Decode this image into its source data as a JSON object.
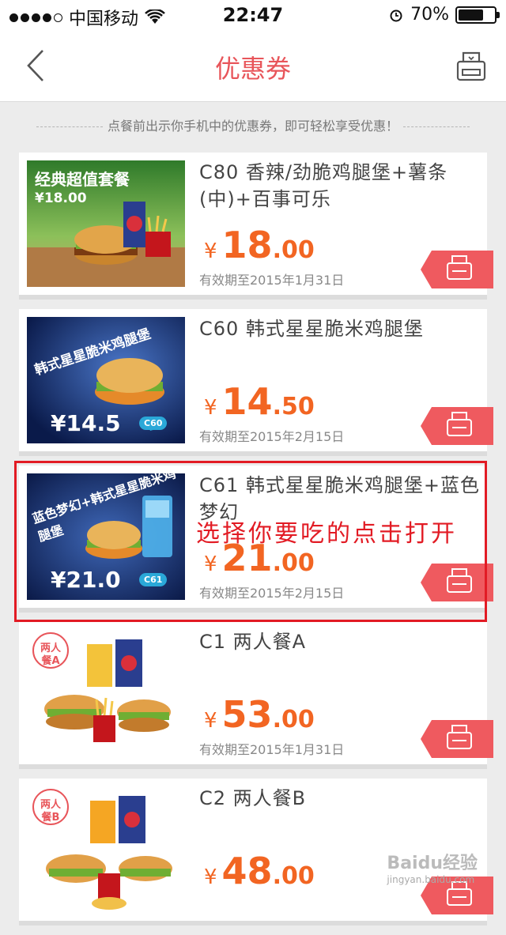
{
  "status": {
    "carrier": "中国移动",
    "time": "22:47",
    "battery": "70%",
    "battery_level": 0.7
  },
  "nav": {
    "title": "优惠券"
  },
  "notice": "点餐前出示你手机中的优惠券，即可轻松享受优惠！",
  "coupons": [
    {
      "name": "C80 香辣/劲脆鸡腿堡+薯条(中)+百事可乐",
      "price_int": "18",
      "price_dec": ".00",
      "expiry": "有效期至2015年1月31日",
      "banner_title": "经典超值套餐",
      "banner_price": "¥18.00"
    },
    {
      "name": "C60 韩式星星脆米鸡腿堡",
      "price_int": "14",
      "price_dec": ".50",
      "expiry": "有效期至2015年2月15日",
      "banner_title": "韩式星星脆米鸡腿堡",
      "banner_price": "¥14.5",
      "banner_code": "C60"
    },
    {
      "name": "C61 韩式星星脆米鸡腿堡+蓝色梦幻",
      "price_int": "21",
      "price_dec": ".00",
      "expiry": "有效期至2015年2月15日",
      "banner_title": "蓝色梦幻+韩式星星脆米鸡腿堡",
      "banner_price": "¥21.0",
      "banner_code": "C61"
    },
    {
      "name": "C1 两人餐A",
      "price_int": "53",
      "price_dec": ".00",
      "expiry": "有效期至2015年1月31日",
      "banner_title": "两人餐A"
    },
    {
      "name": "C2 两人餐B",
      "price_int": "48",
      "price_dec": ".00",
      "expiry": "",
      "banner_title": "两人餐B"
    }
  ],
  "annotation": "选择你要吃的点击打开",
  "currency_symbol": "¥",
  "watermark": "Baidu经验",
  "watermark_sub": "jingyan.baidu.com",
  "colors": {
    "accent": "#e8555a",
    "price": "#f26522",
    "highlight": "#e21b24"
  }
}
